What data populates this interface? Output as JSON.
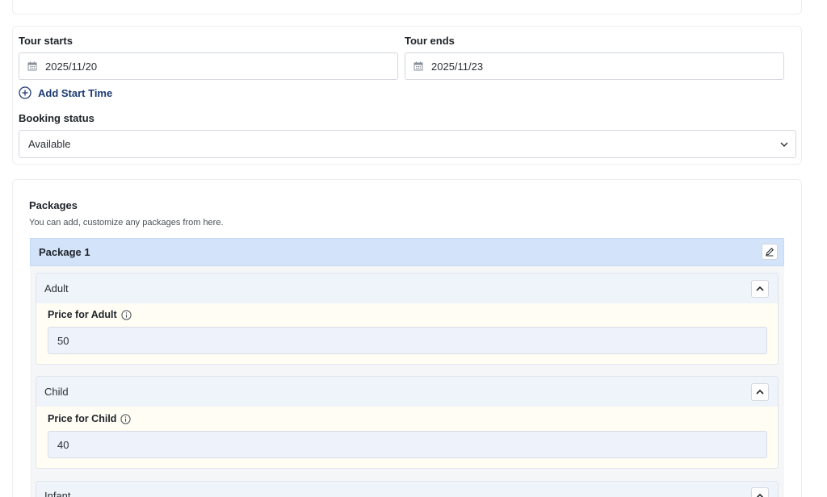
{
  "dates": {
    "start_label": "Tour starts",
    "start_value": "2025/11/20",
    "end_label": "Tour ends",
    "end_value": "2025/11/23",
    "add_start_time": "Add Start Time"
  },
  "booking": {
    "label": "Booking status",
    "value": "Available"
  },
  "packages": {
    "title": "Packages",
    "description": "You can add, customize any packages from here.",
    "package_name": "Package 1",
    "sections": [
      {
        "name": "Adult",
        "price_label": "Price for Adult",
        "price_value": "50"
      },
      {
        "name": "Child",
        "price_label": "Price for Child",
        "price_value": "40"
      },
      {
        "name": "Infant"
      }
    ]
  },
  "colors": {
    "accent": "#1f3b73",
    "package_header_bg": "#d3e3fa",
    "section_head_bg": "#eff3fa",
    "section_body_bg": "#fffdf4",
    "price_input_bg": "#eef2fa"
  },
  "icons": {
    "calendar": "calendar-icon",
    "add": "plus-circle-icon",
    "select": "chevron-down-icon",
    "edit": "pencil-icon",
    "collapse": "chevron-up-icon",
    "info": "info-icon"
  }
}
